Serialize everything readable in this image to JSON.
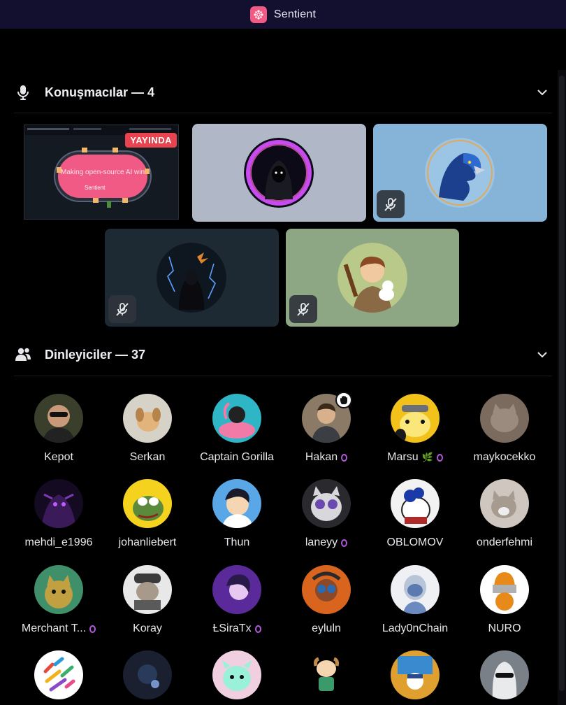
{
  "app": {
    "title": "Sentient",
    "accent": "#f05a84"
  },
  "speakers": {
    "title": "Konuşmacılar — 4",
    "stream": {
      "live_label": "YAYINDA",
      "table_text": "Making open-source AI win",
      "brand": "Sentient"
    }
  },
  "listeners": {
    "title": "Dinleyiciler — 37",
    "items": [
      {
        "name": "Kepot"
      },
      {
        "name": "Serkan"
      },
      {
        "name": "Captain Gorilla"
      },
      {
        "name": "Hakan"
      },
      {
        "name": "Marsu"
      },
      {
        "name": "maykocekko"
      },
      {
        "name": "mehdi_e1996"
      },
      {
        "name": "johanliebert"
      },
      {
        "name": "Thun"
      },
      {
        "name": "laneyy"
      },
      {
        "name": "OBLOMOV"
      },
      {
        "name": "onderfehmi"
      },
      {
        "name": "Merchant T..."
      },
      {
        "name": "Koray"
      },
      {
        "name": "ȽSiraTx"
      },
      {
        "name": "eyluln"
      },
      {
        "name": "Lady0nChain"
      },
      {
        "name": "NURO"
      }
    ]
  }
}
